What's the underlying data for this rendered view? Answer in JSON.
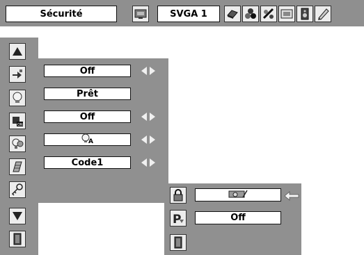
{
  "toolbar": {
    "menu_title": "Sécurité",
    "resolution": "SVGA 1",
    "icons": [
      "monitor-pc-icon",
      "laptop-icon",
      "color-balls-icon",
      "image-adjust-icon",
      "screen-icon",
      "speaker-icon",
      "settings-pencil-icon"
    ]
  },
  "sidebar": {
    "icons": [
      "up-arrow-icon",
      "input-switch-icon",
      "lamp-icon",
      "power-on-icon",
      "lamp-timer-icon",
      "filter-icon",
      "key-icon",
      "down-arrow-icon",
      "exit-door-icon"
    ]
  },
  "settings": {
    "rows": [
      {
        "value": "Off",
        "has_arrows": true
      },
      {
        "value": "Prêt",
        "has_arrows": false
      },
      {
        "value": "Off",
        "has_arrows": true
      },
      {
        "value": "",
        "icon": "lamp-a-icon",
        "has_arrows": true
      },
      {
        "value": "Code1",
        "has_arrows": true
      }
    ]
  },
  "submenu": {
    "rows": [
      {
        "icon": "lock-icon",
        "value": "",
        "value_icon": "projector-lock-icon"
      },
      {
        "icon": "p-lock-icon",
        "value": "Off"
      },
      {
        "icon": "exit-door-icon",
        "value": ""
      }
    ]
  },
  "colors": {
    "panel": "#909090",
    "field_bg": "#ffffff",
    "border": "#111111"
  }
}
